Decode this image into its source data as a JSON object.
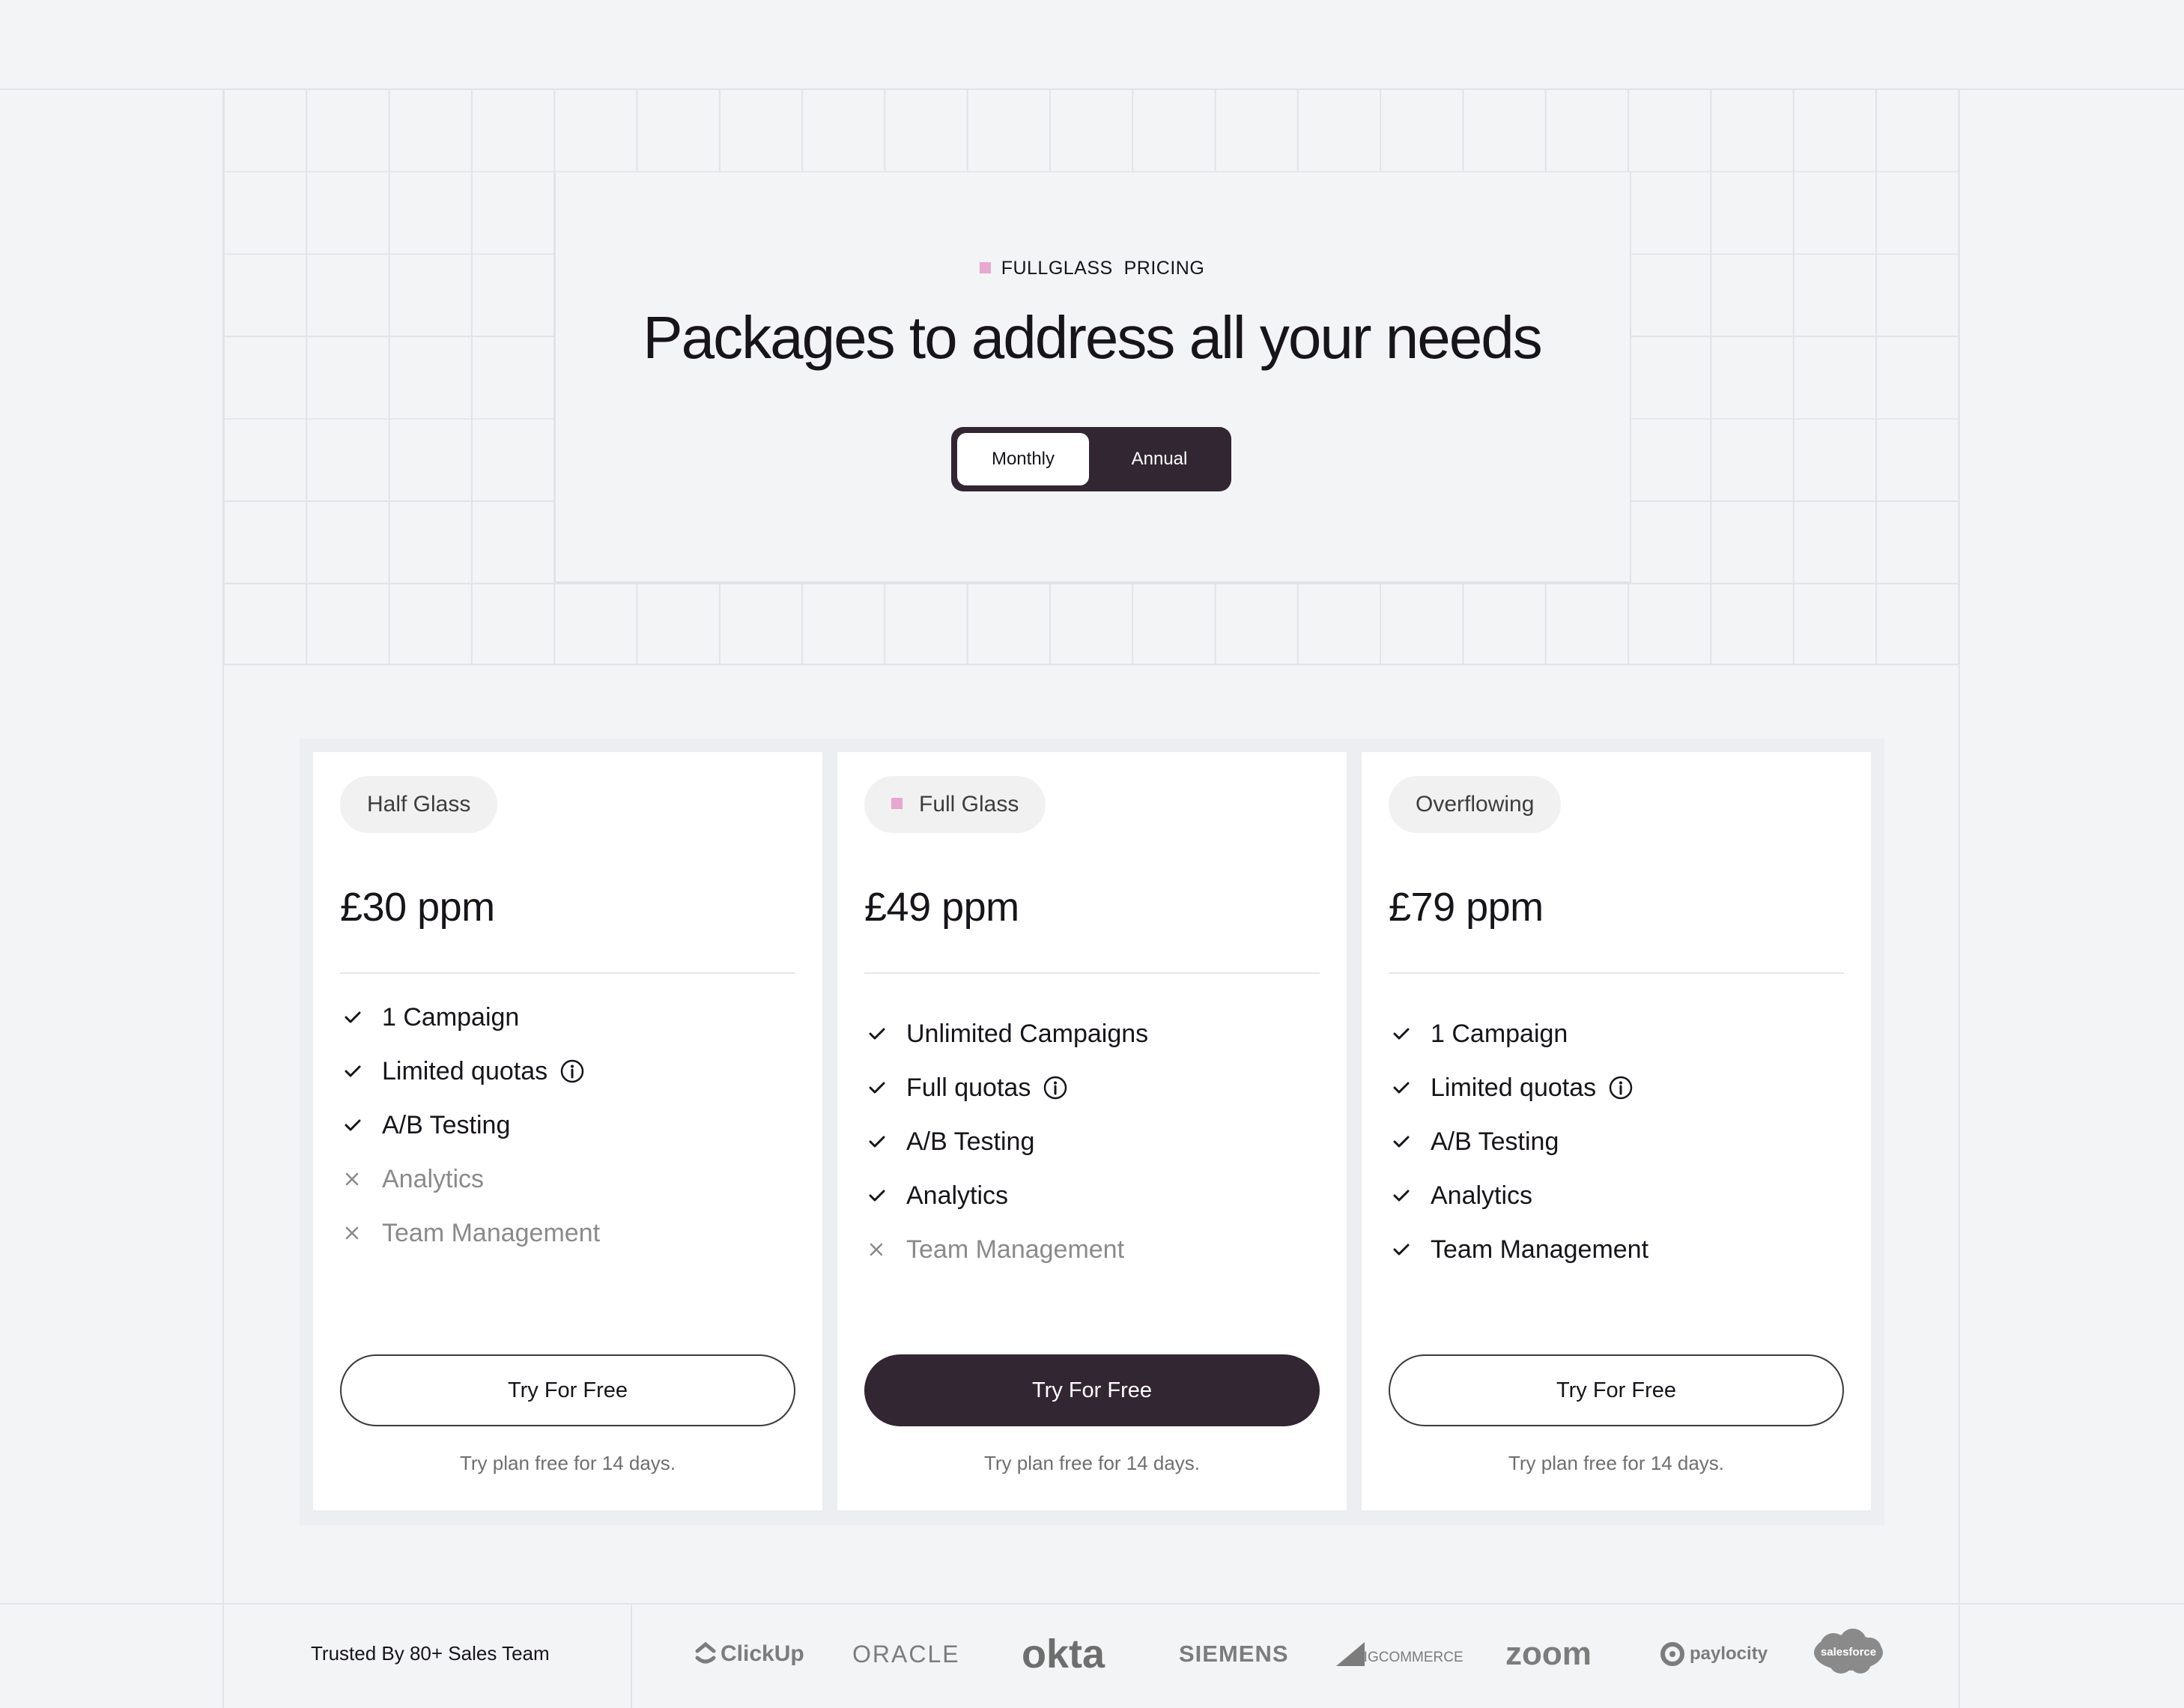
{
  "colors": {
    "accent_pink": "#e7a7cf",
    "dark": "#322633",
    "background": "#f3f4f6"
  },
  "hero": {
    "eyebrow": "FULLGLASS  PRICING",
    "title": "Packages to address all your needs"
  },
  "billing_toggle": {
    "options": [
      "Monthly",
      "Annual"
    ],
    "selected": "Monthly"
  },
  "plans": [
    {
      "name": "Half Glass",
      "price": "£30 ppm",
      "highlighted": false,
      "features": [
        {
          "label": "1 Campaign",
          "included": true,
          "info": false
        },
        {
          "label": "Limited quotas",
          "included": true,
          "info": true
        },
        {
          "label": "A/B Testing",
          "included": true,
          "info": false
        },
        {
          "label": "Analytics",
          "included": false,
          "info": false
        },
        {
          "label": "Team Management",
          "included": false,
          "info": false
        }
      ],
      "cta": "Try For Free",
      "note": "Try plan free for 14 days."
    },
    {
      "name": "Full Glass",
      "price": "£49 ppm",
      "highlighted": true,
      "features": [
        {
          "label": "Unlimited Campaigns",
          "included": true,
          "info": false
        },
        {
          "label": "Full quotas",
          "included": true,
          "info": true
        },
        {
          "label": "A/B Testing",
          "included": true,
          "info": false
        },
        {
          "label": "Analytics",
          "included": true,
          "info": false
        },
        {
          "label": "Team Management",
          "included": false,
          "info": false
        }
      ],
      "cta": "Try For Free",
      "note": "Try plan free for 14 days."
    },
    {
      "name": "Overflowing",
      "price": "£79 ppm",
      "highlighted": false,
      "features": [
        {
          "label": "1 Campaign",
          "included": true,
          "info": false
        },
        {
          "label": "Limited quotas",
          "included": true,
          "info": true
        },
        {
          "label": "A/B Testing",
          "included": true,
          "info": false
        },
        {
          "label": "Analytics",
          "included": true,
          "info": false
        },
        {
          "label": "Team Management",
          "included": true,
          "info": false
        }
      ],
      "cta": "Try For Free",
      "note": "Try plan free for 14 days."
    }
  ],
  "footer": {
    "trusted": "Trusted By 80+ Sales Team",
    "logos": [
      "ClickUp",
      "ORACLE",
      "okta",
      "SIEMENS",
      "BIGCOMMERCE",
      "zoom",
      "paylocity",
      "salesforce"
    ]
  }
}
